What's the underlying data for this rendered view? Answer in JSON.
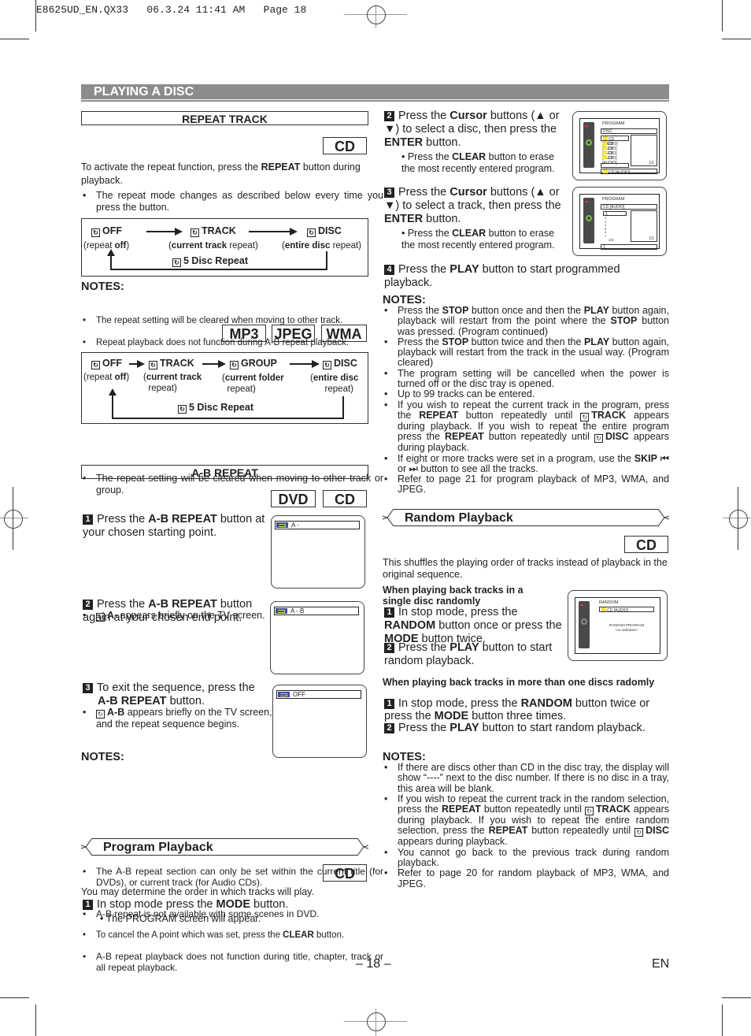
{
  "slug": "E8625UD_EN.QX33   06.3.24 11:41 AM   Page 18",
  "section_title": "PLAYING A DISC",
  "left": {
    "repeat_track": {
      "title": "REPEAT TRACK",
      "badge_cd": "CD",
      "intro_pre": "To activate the repeat function, press the ",
      "intro_bold": "REPEAT",
      "intro_post": " button during playback.",
      "bullet": "The repeat mode changes as described below every time you press the button.",
      "flow_cd": {
        "off": "OFF",
        "track": "TRACK",
        "disc": "DISC",
        "off_sub_pre": "(repeat ",
        "off_sub_bold": "off",
        "off_sub_post": ")",
        "track_sub_pre": "(",
        "track_sub_bold": "current track",
        "track_sub_post": " repeat)",
        "disc_sub_pre": "(",
        "disc_sub_bold": "entire disc",
        "disc_sub_post": " repeat)",
        "five_disc": "5 Disc Repeat"
      },
      "notes_heading": "NOTES:",
      "notes": [
        "The repeat setting will be cleared when moving to other track.",
        "Repeat playback does not function during A-B repeat playback."
      ],
      "badges_mp3": [
        "MP3",
        "JPEG",
        "WMA"
      ],
      "flow_mp3": {
        "off": "OFF",
        "track": "TRACK",
        "group": "GROUP",
        "disc": "DISC",
        "off_sub_pre": "(repeat ",
        "off_sub_bold": "off",
        "off_sub_post": ")",
        "track_sub_bold": "current track",
        "track_sub_post": "repeat)",
        "group_sub_bold": "current folder",
        "group_sub_post": "repeat)",
        "disc_sub_bold": "entire disc",
        "disc_sub_post": "repeat)",
        "five_disc": "5 Disc Repeat"
      },
      "mp3_bullet": "The repeat setting will be cleared when moving to other track or group."
    },
    "ab_repeat": {
      "title": "A-B REPEAT",
      "badges": [
        "DVD",
        "CD"
      ],
      "step1_pre": "Press the ",
      "step1_bold": "A-B REPEAT",
      "step1_post": " button at your chosen starting point.",
      "step1_bullet_bold": "A-",
      "step1_bullet_post": " appears briefly on the TV screen.",
      "step2_pre": "Press the ",
      "step2_bold": "A-B REPEAT",
      "step2_post": " button again at your chosen end point.",
      "step2_bullet_bold": "A-B",
      "step2_bullet_post": " appears briefly on the TV screen, and the repeat sequence begins.",
      "step3_pre": "To exit the sequence, press the ",
      "step3_bold": "A-B REPEAT",
      "step3_post": " button.",
      "tv_screens": [
        "A -",
        "A - B",
        "OFF"
      ],
      "notes_heading": "NOTES:",
      "notes": [
        "The A-B repeat section can only be set within the current title (for DVDs), or current track (for Audio CDs).",
        "A-B repeat is not available with some scenes in DVD.",
        "A-B repeat playback does not function during title, chapter, track or all repeat playback."
      ],
      "note_clear_pre": "To cancel the A point which was set, press the ",
      "note_clear_bold": "CLEAR",
      "note_clear_post": " button."
    },
    "program": {
      "title": "Program Playback",
      "badge_cd": "CD",
      "intro": "You may determine the order in which tracks will play.",
      "step1_pre": "In stop mode press the ",
      "step1_bold": "MODE",
      "step1_post": " button.",
      "step1_sub": "• The PROGRAM screen will appear."
    }
  },
  "right": {
    "program_steps": {
      "step2_pre": "Press the ",
      "step2_bold": "Cursor",
      "step2_mid": " buttons (▲ or ▼) to select a disc, then press the ",
      "step2_bold2": "ENTER",
      "step2_post": " button.",
      "step2_sub_pre": "• Press the ",
      "step2_sub_bold": "CLEAR",
      "step2_sub_post": " button to erase the most recently entered program.",
      "step3_pre": "Press the ",
      "step3_bold": "Cursor",
      "step3_mid": " buttons (▲ or ▼) to select a track, then press the ",
      "step3_bold2": "ENTER",
      "step3_post": " button.",
      "step3_sub_pre": "• Press the ",
      "step3_sub_bold": "CLEAR",
      "step3_sub_post": " button to erase the most recently entered program.",
      "step4_pre": "Press the ",
      "step4_bold": "PLAY",
      "step4_post": " button to start programmed playback.",
      "screen1": {
        "title": "PROGRAM",
        "header": "DISC",
        "rows": [
          "CD [AUDIO]",
          "CD [AUDIO]",
          "CD [AUDIO]",
          "CD [AUDIO]",
          "CD [AUDIO]"
        ],
        "page": "1/1",
        "footer": "CD [AUDIO]"
      },
      "screen2": {
        "title": "PROGRAM",
        "header": "CD [AUDIO]",
        "rows": [
          "1",
          "2",
          "3",
          "4",
          "5",
          "6",
          "7"
        ],
        "page_left": "1/2",
        "page": "1/1",
        "footer": "1"
      }
    },
    "program_notes": {
      "heading": "NOTES:",
      "n1": "Press the STOP button once and then the PLAY button again, playback will restart from the point where the STOP button was pressed. (Program continued)",
      "n2": "Press the STOP button twice and then the PLAY button again, playback will restart from the track in the usual way. (Program cleared)",
      "n3": "The program setting will be cancelled when the power is turned off or the disc tray is opened.",
      "n4": "Up to 99 tracks can be entered.",
      "n5": "If you wish to repeat the current track in the program, press the REPEAT button repeatedly until TRACK appears during playback. If you wish to repeat the entire program press the REPEAT button repeatedly until DISC appears during playback.",
      "n6": "If eight or more tracks were set in a program, use the SKIP ◀◀ or ▶▶ button to see all the tracks.",
      "n7": "Refer to page 21 for program playback of MP3, WMA, and JPEG."
    },
    "random": {
      "title": "Random Playback",
      "badge_cd": "CD",
      "intro": "This shuffles the playing order of tracks instead of playback in the original sequence.",
      "single_heading": "When playing back tracks in a single disc randomly",
      "s1_pre": "In stop mode, press the ",
      "s1_bold": "RANDOM",
      "s1_mid": " button once or press the ",
      "s1_bold2": "MODE",
      "s1_post": " button twice.",
      "s2_pre": "Press the ",
      "s2_bold": "PLAY",
      "s2_post": " button to start random playback.",
      "screen": {
        "title": "RANDOM",
        "row": "CD [AUDIO]",
        "line1": "RANDOM PROGRAM",
        "line2": "--no indication--"
      },
      "multi_heading": "When playing back tracks in more than one discs radomly",
      "m1_pre": "In stop mode, press the ",
      "m1_bold": "RANDOM",
      "m1_mid": " button twice or press the ",
      "m1_bold2": "MODE",
      "m1_post": " button three times.",
      "m2_pre": "Press the ",
      "m2_bold": "PLAY",
      "m2_post": " button to start random playback.",
      "notes_heading": "NOTES:",
      "n1": "If there are discs other than CD in the disc tray, the display will show “----” next to the disc number. If there is no disc in a tray, this area will be blank.",
      "n2": "If you wish to repeat the current track in the random selection, press the REPEAT button repeatedly until TRACK appears during playback. If you wish to repeat the entire random selection, press the REPEAT button repeatedly until DISC appears during playback.",
      "n3": "You cannot go back to the previous track during random playback.",
      "n4": "Refer to page 20 for random playback of MP3, WMA, and JPEG."
    }
  },
  "footer": {
    "page_number": "– 18 –",
    "lang": "EN"
  },
  "icons": {
    "repeat": "repeat-icon",
    "num": "step-number-icon"
  }
}
